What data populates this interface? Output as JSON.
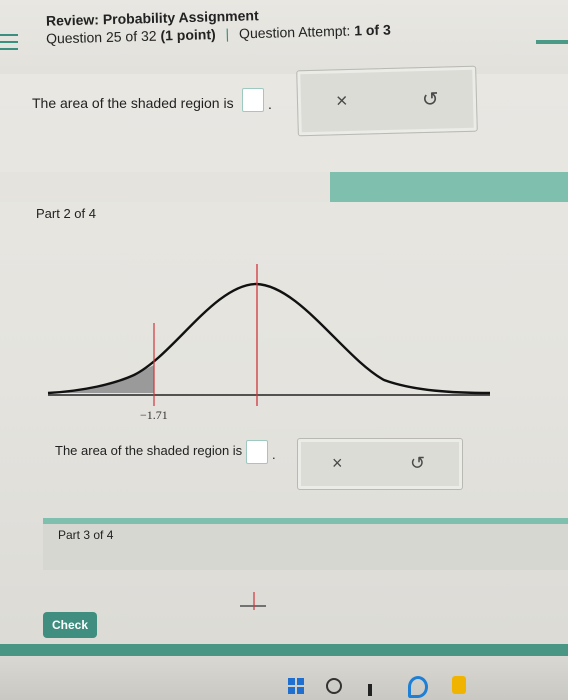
{
  "header": {
    "title": "Review: Probability Assignment",
    "question": "Question 25 of 32",
    "points": "(1 point)",
    "attempt_label": "Question Attempt:",
    "attempt_value": "1 of 3"
  },
  "part1": {
    "area_text": "The area of the shaded region is",
    "period": ".",
    "clear_icon": "×",
    "undo_icon": "↺"
  },
  "part2": {
    "label": "Part 2 of 4",
    "tick_label": "−1.71",
    "area_text": "The area of the shaded region is",
    "period": ".",
    "clear_icon": "×",
    "undo_icon": "↺"
  },
  "part3": {
    "label": "Part 3 of 4"
  },
  "check_label": "Check",
  "colors": {
    "accent": "#3f8e80",
    "band": "#7fbfae",
    "mean_line": "#d0363c",
    "shade": "#9a9a9a"
  },
  "icons": [
    "menu-icon",
    "clear-icon",
    "undo-icon",
    "windows-icon",
    "search-icon"
  ]
}
